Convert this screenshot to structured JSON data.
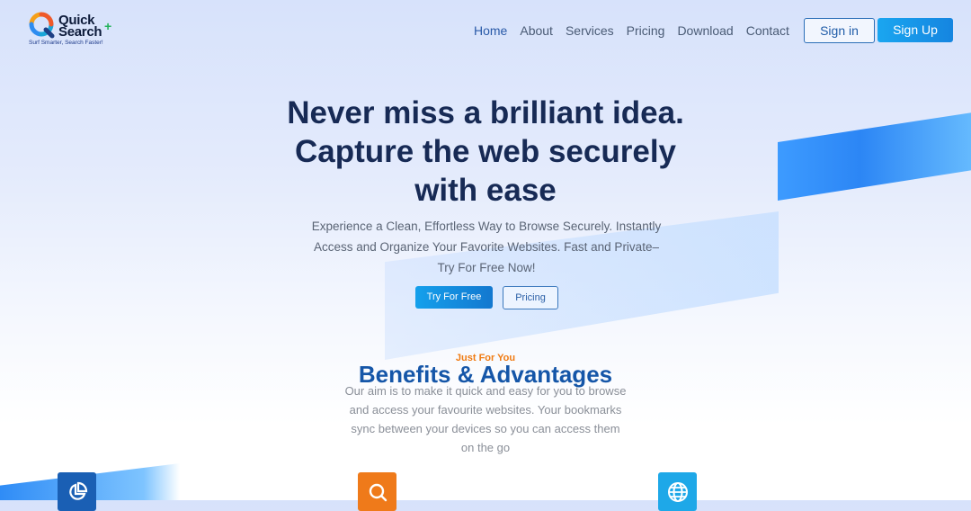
{
  "brand": {
    "name_line1": "Quick",
    "name_line2": "Search",
    "plus_mark": "+",
    "tagline": "Surf Smarter, Search Faster!",
    "colors": {
      "primary": "#1585e0",
      "navy": "#172a55",
      "orange": "#f07b12",
      "green": "#25b35b"
    }
  },
  "nav": {
    "items": [
      "Home",
      "About",
      "Services",
      "Pricing",
      "Download",
      "Contact"
    ],
    "active": "Home",
    "sign_in": "Sign in",
    "sign_up": "Sign Up"
  },
  "hero": {
    "title": "Never miss a brilliant idea. Capture the web securely with ease",
    "subtitle": "Experience a Clean, Effortless Way to Browse Securely. Instantly Access and Organize Your Favorite Websites. Fast and Private– Try For Free Now!",
    "cta_primary": "Try For Free",
    "cta_secondary": "Pricing"
  },
  "benefits": {
    "eyebrow": "Just For You",
    "title": "Benefits & Advantages",
    "text": "Our aim is to make it quick and easy for you to browse and access your favourite websites. Your bookmarks sync between your devices so you can access them on the go",
    "card_icons": [
      "pie-chart-icon",
      "search-icon",
      "globe-icon"
    ]
  }
}
